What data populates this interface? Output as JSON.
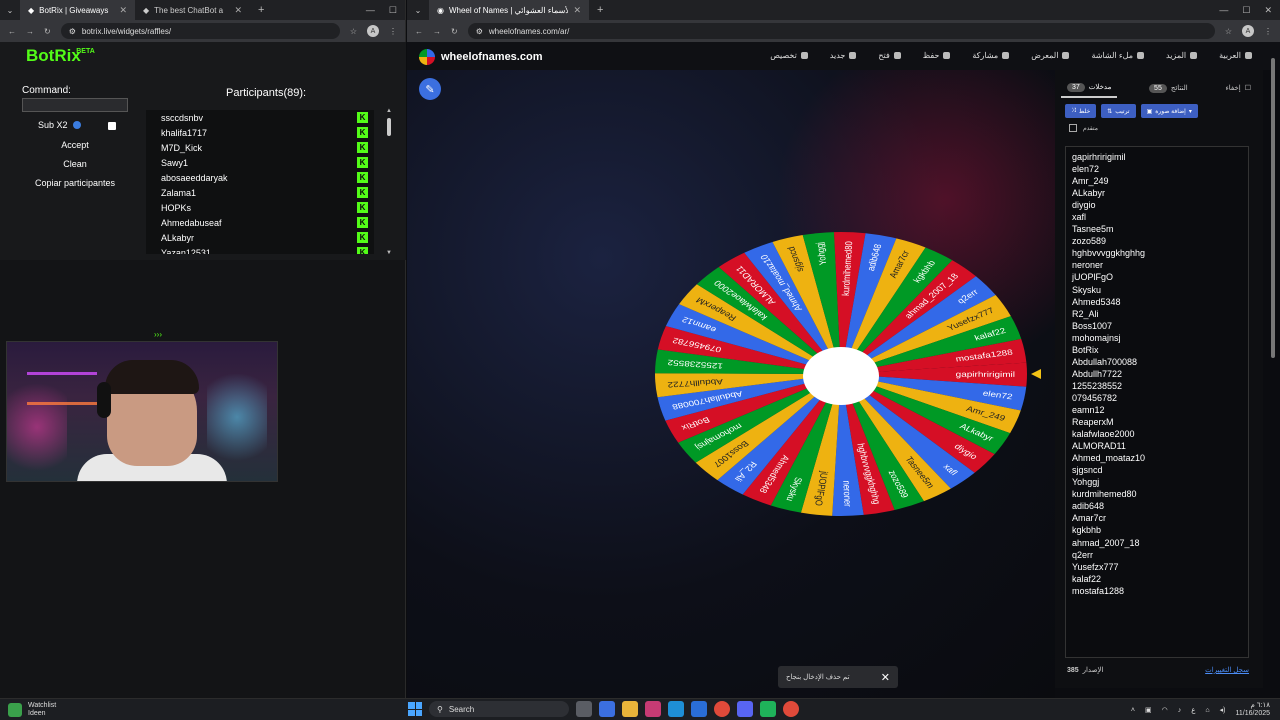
{
  "left_browser": {
    "tabs": [
      {
        "label": "BotRix | Giveaways",
        "active": true
      },
      {
        "label": "The best ChatBot a",
        "active": false
      }
    ],
    "url": "botrix.live/widgets/raffles/",
    "profile": "A"
  },
  "botrix": {
    "logo": "BotRix",
    "beta": "BETA",
    "command_label": "Command:",
    "command_value": "",
    "sub_label": "Sub X2",
    "accept": "Accept",
    "clean": "Clean",
    "copy": "Copiar participantes",
    "participants_title": "Participants(89):",
    "participants": [
      "ssccdsnbv",
      "khalifa1717",
      "M7D_Kick",
      "Sawy1",
      "abosaeeddaryak",
      "Zalama1",
      "HOPKs",
      "Ahmedabuseaf",
      "ALkabyr",
      "Yazan12531"
    ],
    "badge": "K"
  },
  "webcam": {
    "indicator": "›››"
  },
  "right_browser": {
    "tab": "Wheel of Names | عجلة الأسماء العشوائي",
    "url": "wheelofnames.com/ar/",
    "profile": "A"
  },
  "wheel_site": {
    "brand": "wheelofnames.com",
    "menu": [
      "العربية",
      "المزيد",
      "ملء الشاشة",
      "المعرض",
      "مشاركة",
      "حفظ",
      "فتح",
      "جديد",
      "تخصيص"
    ],
    "tabs": {
      "hide": "إخفاء",
      "results_label": "النتائج",
      "results_count": "55",
      "entries_label": "مدخلات",
      "entries_count": "37"
    },
    "tools": {
      "shuffle": "خلط",
      "sort": "ترتيب",
      "add_image": "إضافة صورة"
    },
    "advanced": "متقدم",
    "entries": [
      "gapirhririgimil",
      "elen72",
      "Amr_249",
      "ALkabyr",
      "diygio",
      "xafl",
      "Tasnee5m",
      "zozo589",
      "hghbvvvggkhghhg",
      "neroner",
      "jUOPlFgO",
      "Skysku",
      "Ahmed5348",
      "R2_Ali",
      "Boss1007",
      "mohomajnsj",
      "BotRix",
      "Abdullah700088",
      "Abdullh7722",
      "1255238552",
      "079456782",
      "eamn12",
      "ReaperxM",
      "kalafwlaoe2000",
      "ALMORAD11",
      "Ahmed_moataz10",
      "sjgsncd",
      "Yohggj",
      "kurdmihemed80",
      "adib648",
      "Amar7cr",
      "kgkbhb",
      "ahmad_2007_18",
      "q2err",
      "Yusefzx777",
      "kalaf22",
      "mostafa1288"
    ],
    "version_label": "الإصدار",
    "version": "385",
    "changelog": "سجل التغييرات",
    "toast": "تم حذف الإدخال بنجاح",
    "toast_close": "✕",
    "colors": [
      "#d50f25",
      "#3369e8",
      "#eeb211",
      "#009925"
    ]
  },
  "taskbar": {
    "widget_title": "Watchlist",
    "widget_sub": "Ideen",
    "search": "Search",
    "time": "٦:١٨ م",
    "date": "11/16/2025",
    "lang": "ع"
  }
}
